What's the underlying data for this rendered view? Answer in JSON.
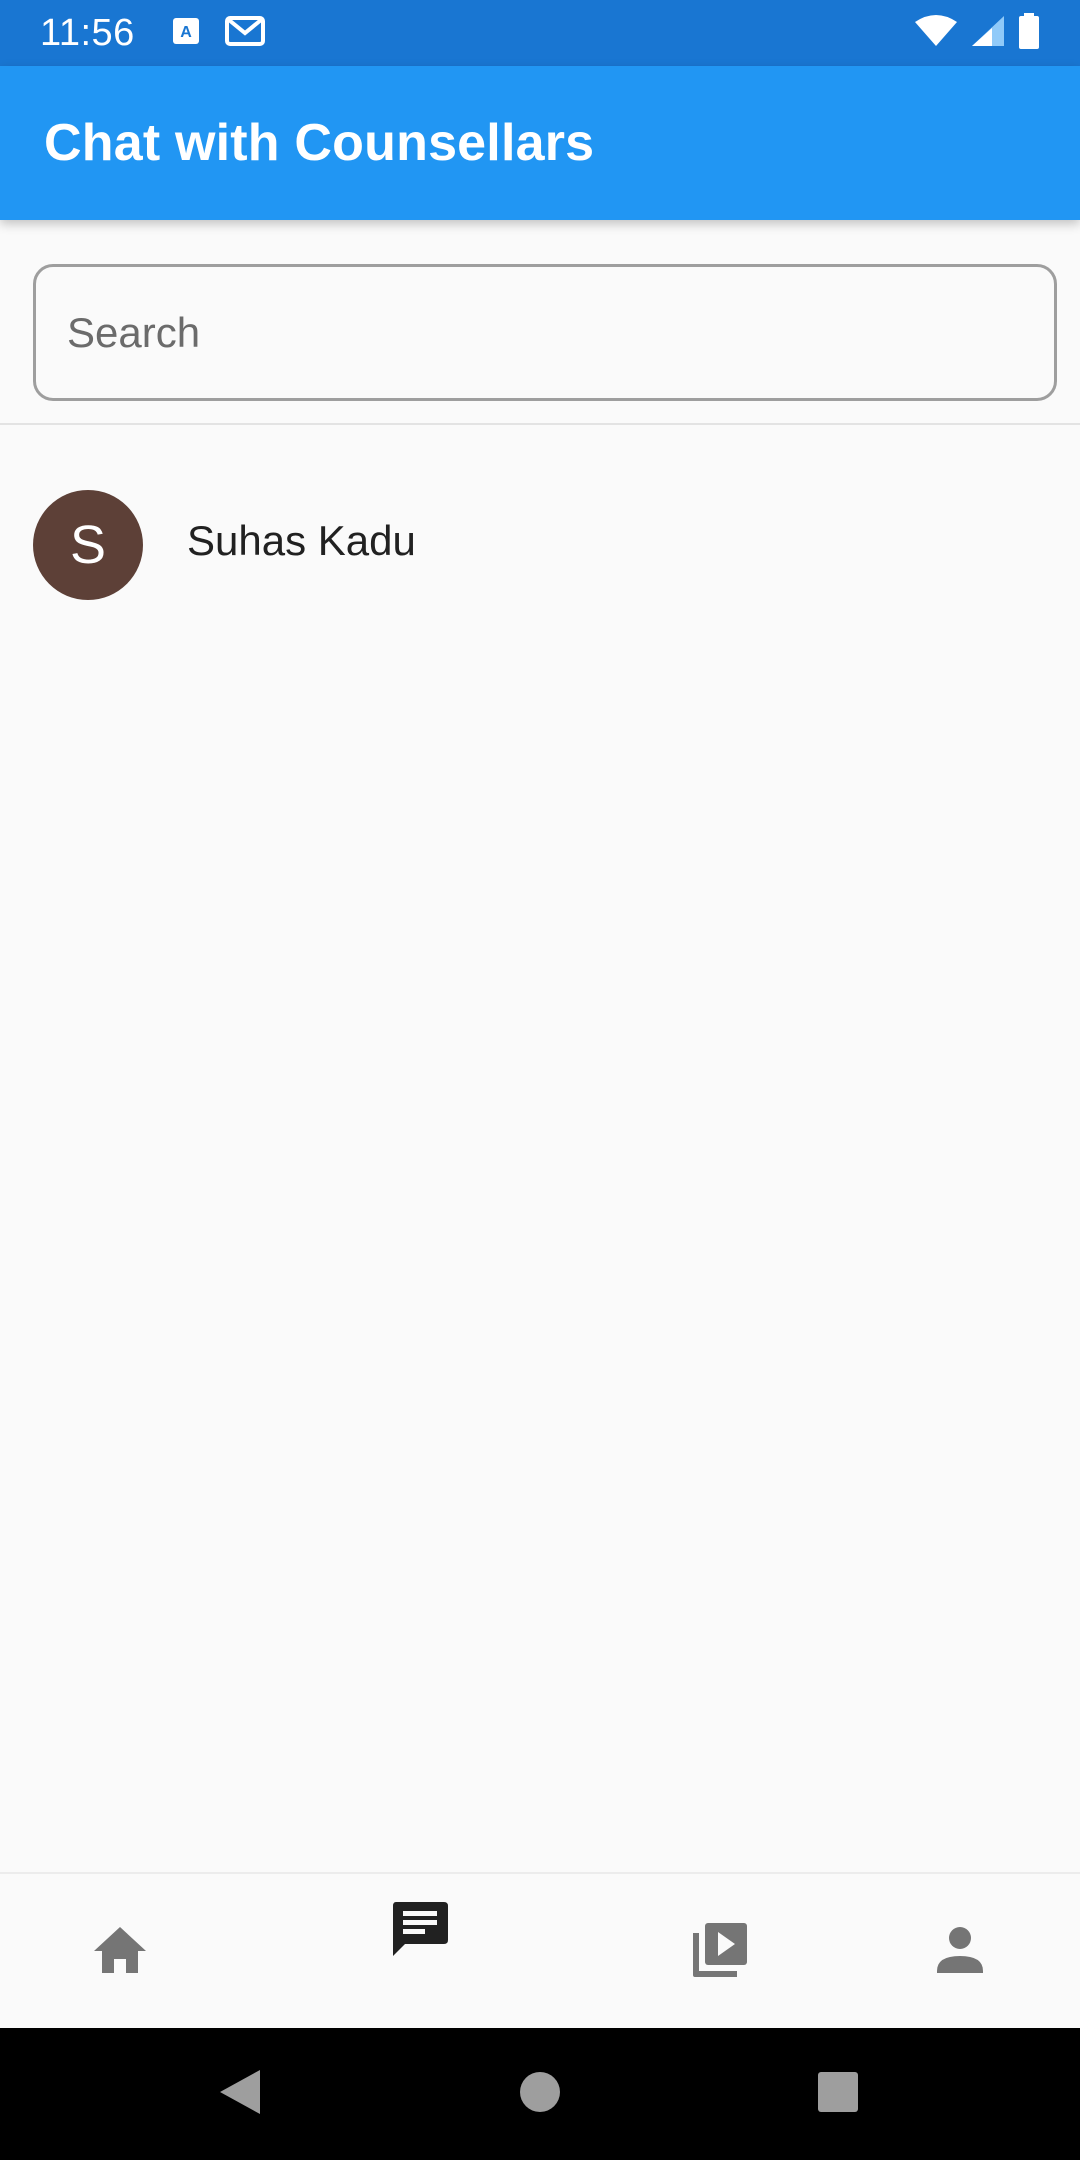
{
  "status_bar": {
    "time": "11:56",
    "notification_icons": [
      "translate-notification-icon",
      "gmail-notification-icon"
    ],
    "right_icons": [
      "wifi-icon",
      "cell-signal-icon",
      "battery-icon"
    ]
  },
  "app_bar": {
    "title": "Chat with Counsellars",
    "color": "#2196f3"
  },
  "search": {
    "placeholder": "Search",
    "value": ""
  },
  "contacts": [
    {
      "initial": "S",
      "name": "Suhas Kadu",
      "avatar_color": "#5d4037"
    }
  ],
  "bottom_nav": {
    "items": [
      {
        "icon": "home-icon",
        "active": false
      },
      {
        "icon": "chat-icon",
        "active": true
      },
      {
        "icon": "video-library-icon",
        "active": false
      },
      {
        "icon": "person-icon",
        "active": false
      }
    ],
    "active_color": "#212121",
    "inactive_color": "#757575"
  },
  "system_nav": {
    "buttons": [
      "back-icon",
      "home-circle-icon",
      "recents-icon"
    ]
  }
}
